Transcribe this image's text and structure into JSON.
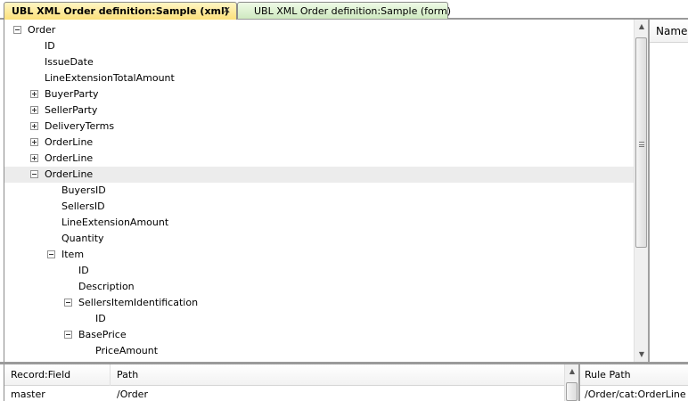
{
  "tabs": [
    {
      "label": "UBL XML Order definition:Sample (xml)",
      "close": "✕"
    },
    {
      "label": "UBL XML Order definition:Sample (form)"
    }
  ],
  "tree": {
    "nodes": [
      {
        "label": "Order",
        "toggle": "minus"
      },
      {
        "label": "ID",
        "toggle": "none"
      },
      {
        "label": "IssueDate",
        "toggle": "none"
      },
      {
        "label": "LineExtensionTotalAmount",
        "toggle": "none"
      },
      {
        "label": "BuyerParty",
        "toggle": "plus"
      },
      {
        "label": "SellerParty",
        "toggle": "plus"
      },
      {
        "label": "DeliveryTerms",
        "toggle": "plus"
      },
      {
        "label": "OrderLine",
        "toggle": "plus"
      },
      {
        "label": "OrderLine",
        "toggle": "plus"
      },
      {
        "label": "OrderLine",
        "toggle": "minus",
        "selected": true
      },
      {
        "label": "BuyersID",
        "toggle": "none"
      },
      {
        "label": "SellersID",
        "toggle": "none"
      },
      {
        "label": "LineExtensionAmount",
        "toggle": "none"
      },
      {
        "label": "Quantity",
        "toggle": "none"
      },
      {
        "label": "Item",
        "toggle": "minus"
      },
      {
        "label": "ID",
        "toggle": "none"
      },
      {
        "label": "Description",
        "toggle": "none"
      },
      {
        "label": "SellersItemIdentification",
        "toggle": "minus"
      },
      {
        "label": "ID",
        "toggle": "none"
      },
      {
        "label": "BasePrice",
        "toggle": "minus"
      },
      {
        "label": "PriceAmount",
        "toggle": "none"
      }
    ]
  },
  "right_panel": {
    "header": "Name"
  },
  "bottom_grid": {
    "columns": [
      "Record:Field",
      "Path"
    ],
    "rows": [
      {
        "record_field": "master",
        "path": "/Order"
      }
    ]
  },
  "rule_panel": {
    "header": "Rule Path",
    "value": "/Order/cat:OrderLine"
  },
  "scroll_icons": {
    "up": "▲",
    "down": "▼"
  }
}
